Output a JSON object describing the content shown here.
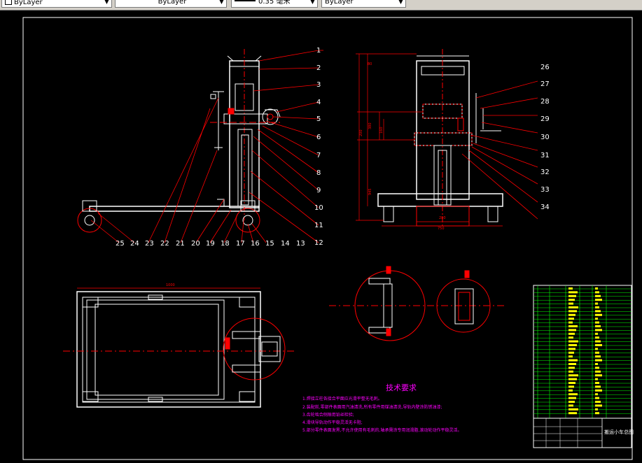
{
  "toolbar": {
    "color_value": "ByLayer",
    "linetype_value": "ByLayer",
    "lineweight_value": "0.35 毫米",
    "plotstyle_value": "ByLayer"
  },
  "drawing": {
    "balloons_top": [
      "1",
      "2",
      "3",
      "4",
      "5",
      "6",
      "7",
      "8",
      "9",
      "10",
      "11",
      "12"
    ],
    "balloons_bottom": [
      "25",
      "24",
      "23",
      "22",
      "21",
      "20",
      "19",
      "18",
      "17",
      "16",
      "15",
      "14",
      "13"
    ],
    "balloons_side": [
      "26",
      "27",
      "28",
      "29",
      "30",
      "31",
      "32",
      "33",
      "34"
    ],
    "tech_title": "技术要求",
    "tech_lines": [
      "1.焊接立柱各接合平面应光滑平整无毛刺。",
      "2.装配前,零部件表面用汽油清洗,所有零件用煤油清洗,导轨内壁涂防锈油漆;",
      "3.齿轮啮合侧隙用铅丝检验;",
      "4.滑块导轨动作平稳灵活无卡阻;",
      "5.部分零件表面发黑,不允许使用有毛刺的,轴承需涂专用润滑脂,滚动轮动作平稳灵活。"
    ],
    "title_block_name": "搬运小车总图"
  },
  "colors": {
    "background": "#000000",
    "outline": "#ffffff",
    "dimension": "#ff0000",
    "tech_title": "#ff00ff",
    "tech_text": "#ff00ff",
    "table_green": "#00ff00",
    "table_yellow": "#ffff00"
  }
}
